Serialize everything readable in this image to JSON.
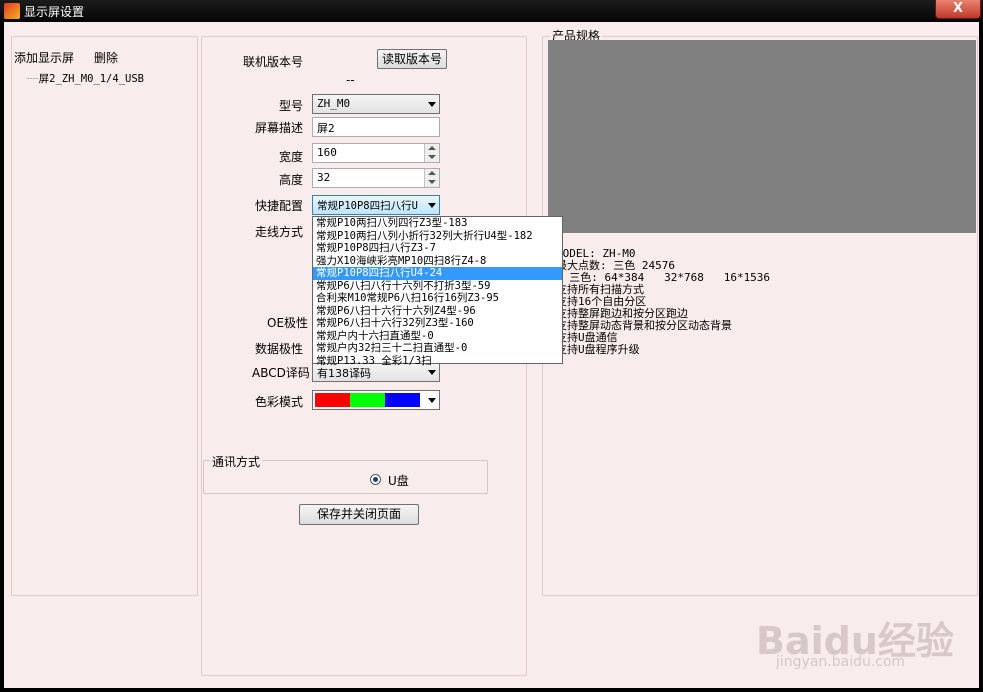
{
  "window": {
    "title": "显示屏设置",
    "close_glyph": "X"
  },
  "left_panel": {
    "add_label": "添加显示屏",
    "delete_label": "删除",
    "tree_items": [
      "屏2_ZH_M0_1/4_USB"
    ]
  },
  "form": {
    "version_label": "联机版本号",
    "read_version_button": "读取版本号",
    "version_value": "--",
    "model_label": "型号",
    "model_value": "ZH_M0",
    "desc_label": "屏幕描述",
    "desc_value": "屏2",
    "width_label": "宽度",
    "width_value": "160",
    "height_label": "高度",
    "height_value": "32",
    "quick_label": "快捷配置",
    "quick_value": "常规P10P8四扫八行U",
    "wiring_label": "走线方式",
    "oe_label": "OE极性",
    "data_polarity_label": "数据极性",
    "abcd_label": "ABCD译码",
    "abcd_value": "有138译码",
    "color_label": "色彩模式",
    "color_swatches": [
      "#ff0000",
      "#00ff00",
      "#0000ff"
    ],
    "comm_group_label": "通讯方式",
    "comm_usb_label": "U盘",
    "comm_usb_selected": true,
    "save_button": "保存并关闭页面"
  },
  "quick_dropdown": {
    "items": [
      "常规P10两扫八列四行Z3型-183",
      "常规P10两扫八列小折行32列大折行U4型-182",
      "常规P10P8四扫八行Z3-7",
      "强力X10海峡彩亮MP10四扫8行Z4-8",
      "常规P10P8四扫八行U4-24",
      "常规P6八扫八行十六列不打折3型-59",
      "合利来M10常规P6八扫16行16列Z3-95",
      "常规P6八扫十六行十六列Z4型-96",
      "常规P6八扫十六行32列Z3型-160",
      "常规户内十六扫直通型-0",
      "常规户内32扫三十二扫直通型-0",
      "常规P13.33 全彩1/3扫"
    ],
    "selected_index": 4
  },
  "spec": {
    "title": "产品规格",
    "lines": [
      "MODEL: ZH-M0",
      "最大点数: 三色 24576",
      "  三色: 64*384   32*768   16*1536",
      "支持所有扫描方式",
      "支持16个自由分区",
      "支持整屏跑边和按分区跑边",
      "支持整屏动态背景和按分区动态背景",
      "支持U盘通信",
      "支持U盘程序升级"
    ]
  },
  "watermark": {
    "text": "Baidu经验",
    "sub": "jingyan.baidu.com"
  }
}
